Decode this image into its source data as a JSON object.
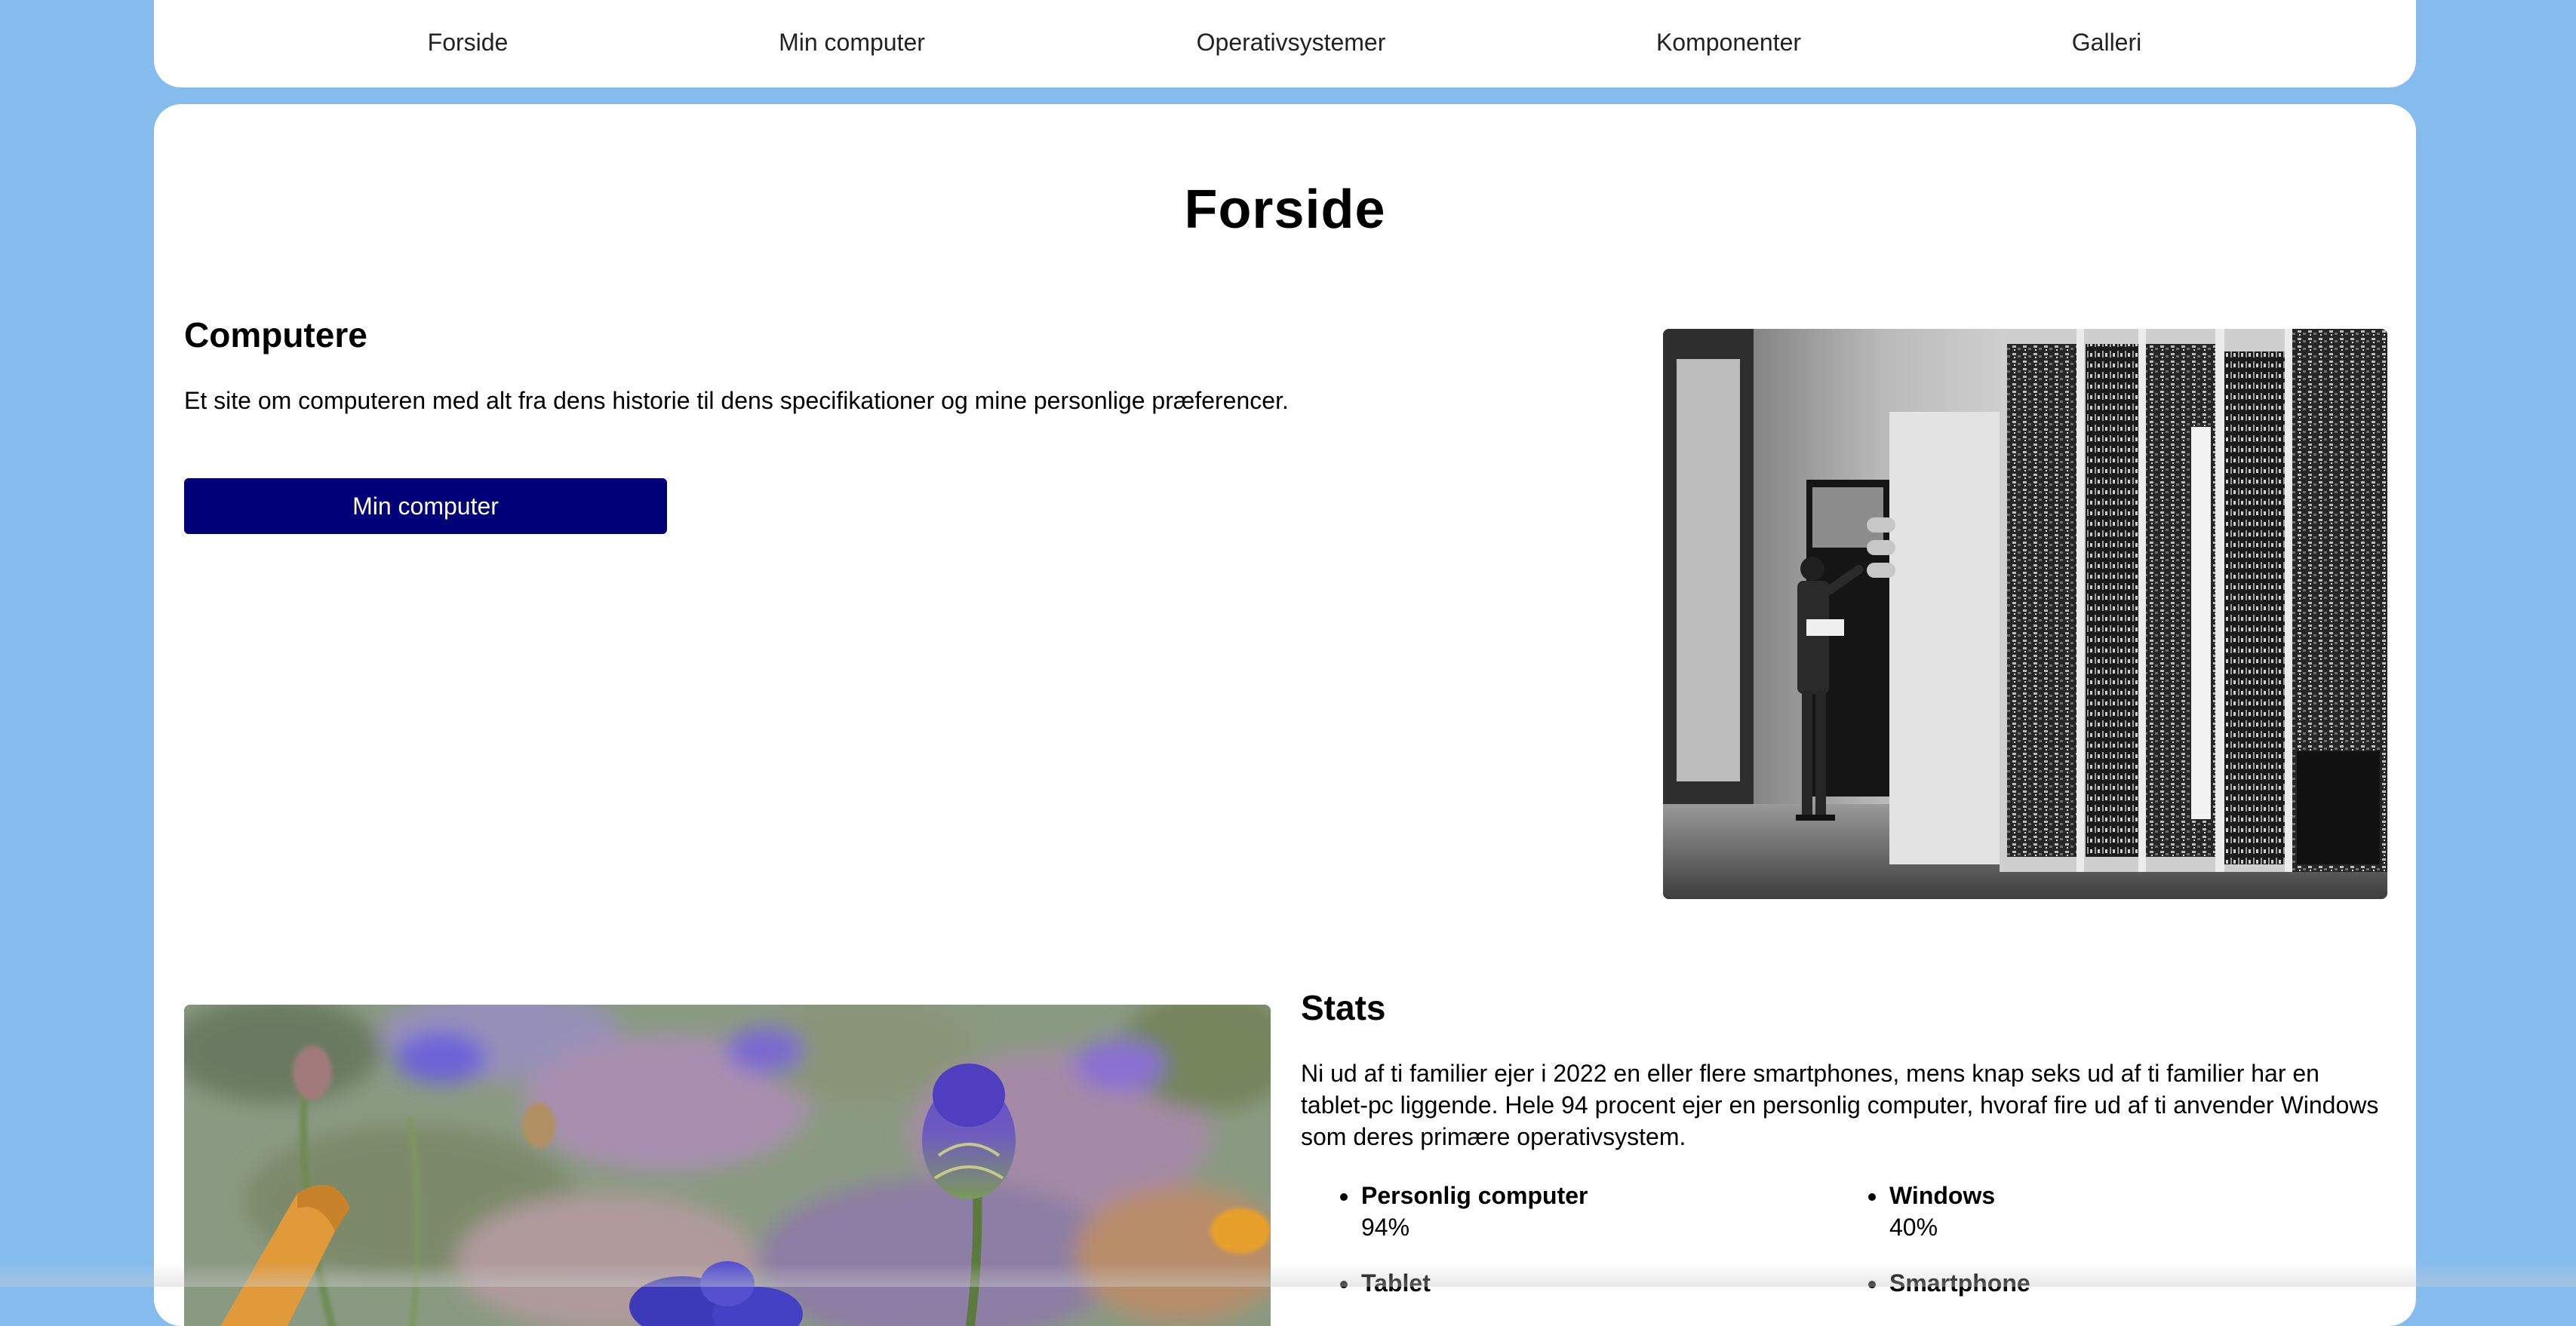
{
  "nav": {
    "items": [
      {
        "label": "Forside"
      },
      {
        "label": "Min computer"
      },
      {
        "label": "Operativsystemer"
      },
      {
        "label": "Komponenter"
      },
      {
        "label": "Galleri"
      }
    ]
  },
  "page": {
    "title": "Forside"
  },
  "intro": {
    "heading": "Computere",
    "text": "Et site om computeren med alt fra dens historie til dens specifikationer og mine personlige præferencer.",
    "button_label": "Min computer"
  },
  "stats": {
    "heading": "Stats",
    "text": "Ni ud af ti familier ejer i 2022 en eller flere smartphones, mens knap seks ud af ti familier har en tablet-pc liggende. Hele 94 procent ejer en personlig computer, hvoraf fire ud af ti anvender Windows som deres primære operativsystem.",
    "items": [
      {
        "label": "Personlig computer",
        "value": "94%"
      },
      {
        "label": "Windows",
        "value": "40%"
      },
      {
        "label": "Tablet",
        "value": ""
      },
      {
        "label": "Smartphone",
        "value": ""
      }
    ]
  }
}
